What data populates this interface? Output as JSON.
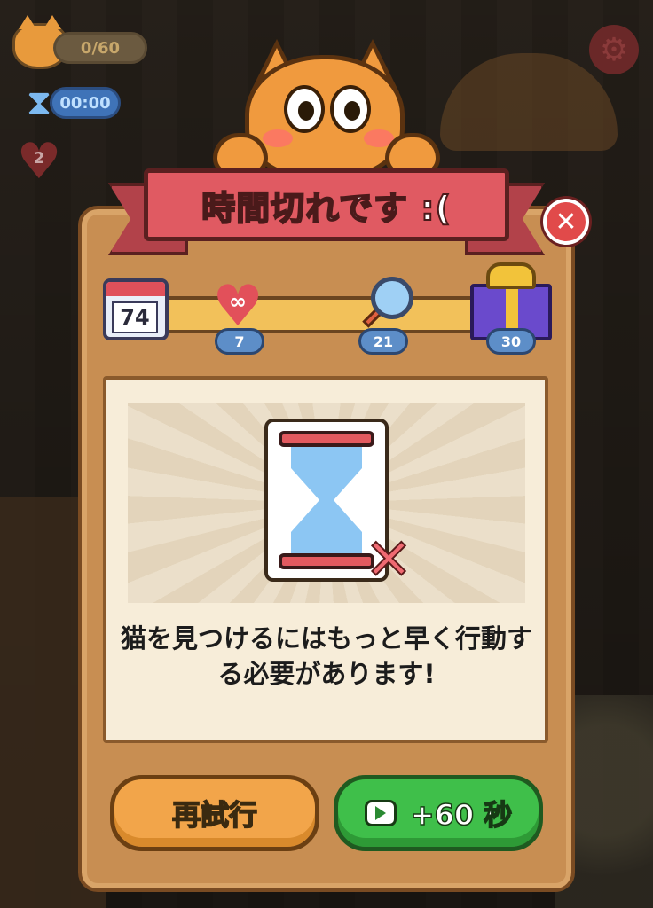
{
  "hud": {
    "cats_found": "0/60",
    "timer": "00:00",
    "hearts": "2"
  },
  "dialog": {
    "title": "時間切れです :(",
    "message": "猫を見つけるにはもっと早く行動する必要があります!",
    "calendar_day": "74",
    "milestones": [
      {
        "icon": "infinite-heart-icon",
        "value": "7"
      },
      {
        "icon": "magnifier-icon",
        "value": "21"
      },
      {
        "icon": "gift-icon",
        "value": "30"
      }
    ],
    "retry_label": "再試行",
    "add_time_label": "+60 秒"
  },
  "icons": {
    "heart_symbol": "∞"
  },
  "colors": {
    "ribbon": "#e05a62",
    "panel": "#c88e52",
    "retry_button": "#f2a54a",
    "add_time_button": "#3fbf4a"
  }
}
